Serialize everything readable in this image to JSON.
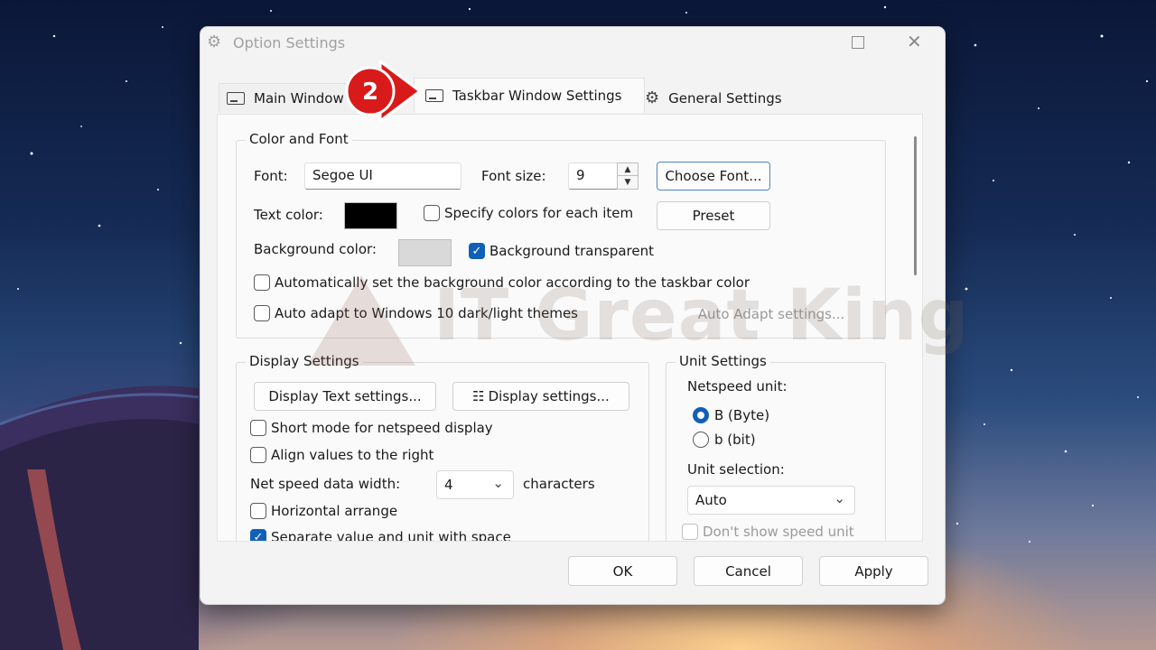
{
  "dialog": {
    "title": "Option Settings",
    "tabs": [
      {
        "label": "Main Window"
      },
      {
        "label": "Taskbar Window Settings"
      },
      {
        "label": "General Settings"
      }
    ],
    "step_number": "2",
    "watermark": "IT Great King"
  },
  "color_font": {
    "title": "Color and Font",
    "font_label": "Font:",
    "font_value": "Segoe UI",
    "font_size_label": "Font size:",
    "font_size_value": "9",
    "choose_font": "Choose Font...",
    "text_color_label": "Text color:",
    "text_color": "#000000",
    "specify_colors": {
      "label": "Specify colors for each item",
      "checked": false
    },
    "preset": "Preset",
    "bg_color_label": "Background color:",
    "bg_color": "#d9d9d9",
    "bg_transparent": {
      "label": "Background transparent",
      "checked": true
    },
    "auto_bg": {
      "label": "Automatically set the background color according to the taskbar color",
      "checked": false
    },
    "auto_adapt": {
      "label": "Auto adapt to Windows 10 dark/light themes",
      "checked": false
    },
    "auto_adapt_settings": "Auto Adapt settings..."
  },
  "display": {
    "title": "Display Settings",
    "display_text_btn": "Display Text settings...",
    "display_settings_btn": "Display settings...",
    "short_mode": {
      "label": "Short mode for netspeed display",
      "checked": false
    },
    "align_right": {
      "label": "Align values to the right",
      "checked": false
    },
    "width_label": "Net speed data width:",
    "width_value": "4",
    "width_unit": "characters",
    "horizontal": {
      "label": "Horizontal arrange",
      "checked": false
    },
    "separate": {
      "label": "Separate value and unit with space",
      "checked": true
    }
  },
  "unit": {
    "title": "Unit Settings",
    "netspeed_label": "Netspeed unit:",
    "byte": {
      "label": "B (Byte)",
      "selected": true
    },
    "bit": {
      "label": "b (bit)",
      "selected": false
    },
    "selection_label": "Unit selection:",
    "selection_value": "Auto",
    "dont_show": {
      "label": "Don't show speed unit",
      "checked": false
    }
  },
  "footer": {
    "ok": "OK",
    "cancel": "Cancel",
    "apply": "Apply"
  }
}
